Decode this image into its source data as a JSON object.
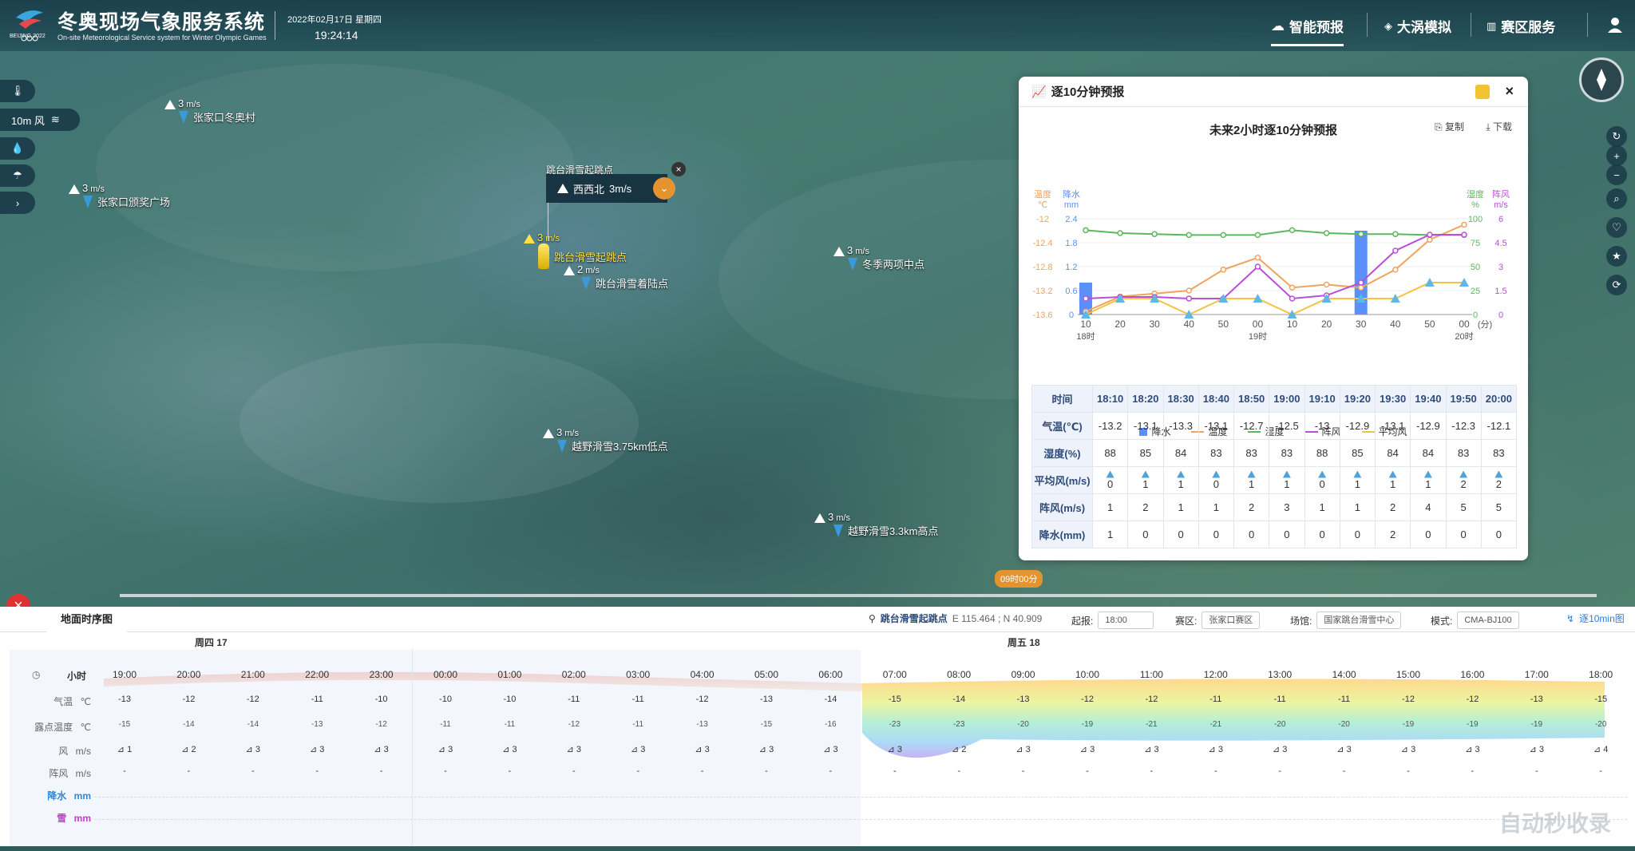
{
  "header": {
    "app_title": "冬奥现场气象服务系统",
    "app_subtitle": "On-site Meteorological Service system for Winter Olympic Games",
    "logo_text": "BEIJING 2022",
    "date": "2022年02月17日 星期四",
    "time": "19:24:14"
  },
  "nav": [
    {
      "label": "智能预报",
      "active": true,
      "icon": "cloud-icon"
    },
    {
      "label": "大涡模拟",
      "active": false,
      "icon": "cube-icon"
    },
    {
      "label": "赛区服务",
      "active": false,
      "icon": "chart-icon"
    }
  ],
  "left_tools": {
    "wind_layer": "10m 风"
  },
  "markers": [
    {
      "name": "张家口冬奥村",
      "wind": "3"
    },
    {
      "name": "张家口颁奖广场",
      "wind": "3"
    },
    {
      "name": "跳台滑雪起跳点",
      "wind": "3"
    },
    {
      "name": "跳台滑雪着陆点",
      "wind": "2"
    },
    {
      "name": "冬季两项中点",
      "wind": "3"
    },
    {
      "name": "越野滑雪3.75km低点",
      "wind": "3"
    },
    {
      "name": "越野滑雪3.3km高点",
      "wind": "3"
    }
  ],
  "wind_unit": "m/s",
  "popup": {
    "title": "跳台滑雪起跳点",
    "dir": "西西北",
    "speed": "3m/s"
  },
  "timeline_badge": "09时00分",
  "forecast_panel": {
    "title": "逐10分钟预报",
    "chart_title": "未来2小时逐10分钟预报",
    "copy": "复制",
    "download": "下载",
    "legend": [
      "降水",
      "温度",
      "湿度",
      "阵风",
      "平均风"
    ],
    "axis_labels": {
      "temp": "温度",
      "temp_unit": "℃",
      "precip": "降水",
      "precip_unit": "mm",
      "hum": "湿度",
      "hum_unit": "%",
      "gust": "阵风",
      "gust_unit": "m/s",
      "min": "(分)",
      "h18": "18时",
      "h19": "19时",
      "h20": "20时"
    },
    "table": {
      "row_labels": [
        "时间",
        "气温(℃)",
        "湿度(%)",
        "平均风(m/s)",
        "阵风(m/s)",
        "降水(mm)"
      ],
      "times": [
        "18:10",
        "18:20",
        "18:30",
        "18:40",
        "18:50",
        "19:00",
        "19:10",
        "19:20",
        "19:30",
        "19:40",
        "19:50",
        "20:00"
      ],
      "temp": [
        "-13.2",
        "-13.1",
        "-13.3",
        "-13.1",
        "-12.7",
        "-12.5",
        "-13",
        "-12.9",
        "-13.1",
        "-12.9",
        "-12.3",
        "-12.1"
      ],
      "hum": [
        "88",
        "85",
        "84",
        "83",
        "83",
        "83",
        "88",
        "85",
        "84",
        "84",
        "83",
        "83"
      ],
      "avg_wind": [
        "0",
        "1",
        "1",
        "0",
        "1",
        "1",
        "0",
        "1",
        "1",
        "1",
        "2",
        "2"
      ],
      "gust": [
        "1",
        "2",
        "1",
        "1",
        "2",
        "3",
        "1",
        "1",
        "2",
        "4",
        "5",
        "5"
      ],
      "precip": [
        "1",
        "0",
        "0",
        "0",
        "0",
        "0",
        "0",
        "0",
        "2",
        "0",
        "0",
        "0"
      ]
    }
  },
  "chart_data": {
    "type": "line",
    "title": "未来2小时逐10分钟预报",
    "categories": [
      "10",
      "20",
      "30",
      "40",
      "50",
      "00",
      "10",
      "20",
      "30",
      "40",
      "50",
      "00"
    ],
    "x_labels": [
      "10",
      "20",
      "30",
      "40",
      "50",
      "00",
      "10",
      "20",
      "30",
      "40",
      "50",
      "00"
    ],
    "series": [
      {
        "name": "降水",
        "type": "bar",
        "axis": "precip",
        "values": [
          0.8,
          0,
          0,
          0,
          0,
          0,
          0,
          0,
          2.1,
          0,
          0,
          0
        ],
        "color": "#5b8ff9"
      },
      {
        "name": "温度",
        "axis": "temp",
        "values": [
          -13.55,
          -13.3,
          -13.25,
          -13.2,
          -12.85,
          -12.65,
          -13.15,
          -13.1,
          -13.15,
          -12.85,
          -12.35,
          -12.1
        ],
        "color": "#f0a35e"
      },
      {
        "name": "湿度",
        "axis": "hum",
        "values": [
          88,
          85,
          84,
          83,
          83,
          83,
          88,
          85,
          84,
          84,
          83,
          83
        ],
        "color": "#5cb85c"
      },
      {
        "name": "阵风",
        "axis": "gust",
        "values": [
          1,
          1.1,
          1.1,
          1,
          1,
          3,
          1,
          1.2,
          2,
          4,
          5,
          5
        ],
        "color": "#b84fd6"
      },
      {
        "name": "平均风",
        "axis": "gust",
        "values": [
          0,
          1,
          1,
          0,
          1,
          1,
          0,
          1,
          1,
          1,
          2,
          2
        ],
        "color": "#f5c342"
      }
    ],
    "temp_ticks": [
      "-12",
      "-12.4",
      "-12.8",
      "-13.2",
      "-13.6"
    ],
    "precip_ticks": [
      "2.4",
      "1.8",
      "1.2",
      "0.6",
      "0"
    ],
    "hum_ticks": [
      "100",
      "75",
      "50",
      "25",
      "0"
    ],
    "gust_ticks": [
      "6",
      "4.5",
      "3",
      "1.5",
      "0"
    ],
    "temp_range": [
      -13.6,
      -12
    ],
    "precip_range": [
      0,
      2.4
    ],
    "hum_range": [
      0,
      100
    ],
    "gust_range": [
      0,
      6
    ]
  },
  "bottom": {
    "tab": "地面时序图",
    "site": "跳台滑雪起跳点",
    "coords": "E 115.464 ; N 40.909",
    "start_label": "起报:",
    "start": "18:00",
    "zone_label": "赛区:",
    "zone": "张家口赛区",
    "venue_label": "场馆:",
    "venue": "国家跳台滑雪中心",
    "model_label": "模式:",
    "model": "CMA-BJ100",
    "link": "逐10min图",
    "day1": "周四 17",
    "day2": "周五 18",
    "row_labels": [
      "小时",
      "气温",
      "露点温度",
      "风",
      "阵风",
      "降水",
      "雪"
    ],
    "row_units": [
      "",
      "℃",
      "℃",
      "m/s",
      "m/s",
      "mm",
      "mm"
    ],
    "hours": [
      "19:00",
      "20:00",
      "21:00",
      "22:00",
      "23:00",
      "00:00",
      "01:00",
      "02:00",
      "03:00",
      "04:00",
      "05:00",
      "06:00",
      "07:00",
      "08:00",
      "09:00",
      "10:00",
      "11:00",
      "12:00",
      "13:00",
      "14:00",
      "15:00",
      "16:00",
      "17:00",
      "18:00"
    ],
    "temp": [
      "-13",
      "-12",
      "-12",
      "-11",
      "-10",
      "-10",
      "-10",
      "-11",
      "-11",
      "-12",
      "-13",
      "-14",
      "-15",
      "-14",
      "-13",
      "-12",
      "-12",
      "-11",
      "-11",
      "-11",
      "-12",
      "-12",
      "-13",
      "-15"
    ],
    "dew": [
      "-15",
      "-14",
      "-14",
      "-13",
      "-12",
      "-11",
      "-11",
      "-12",
      "-11",
      "-13",
      "-15",
      "-16",
      "-23",
      "-23",
      "-20",
      "-19",
      "-21",
      "-21",
      "-20",
      "-20",
      "-19",
      "-19",
      "-19",
      "-20"
    ],
    "wind": [
      "1",
      "2",
      "3",
      "3",
      "3",
      "3",
      "3",
      "3",
      "3",
      "3",
      "3",
      "3",
      "3",
      "2",
      "3",
      "3",
      "3",
      "3",
      "3",
      "3",
      "3",
      "3",
      "3",
      "4"
    ],
    "gust": [
      "-",
      "-",
      "-",
      "-",
      "-",
      "-",
      "-",
      "-",
      "-",
      "-",
      "-",
      "-",
      "-",
      "-",
      "-",
      "-",
      "-",
      "-",
      "-",
      "-",
      "-",
      "-",
      "-",
      "-"
    ]
  },
  "watermark": "自动秒收录"
}
